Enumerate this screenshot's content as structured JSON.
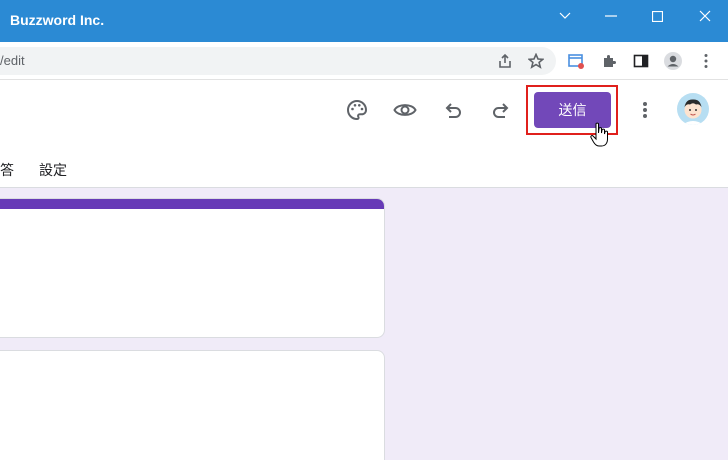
{
  "window": {
    "title": "Buzzword Inc."
  },
  "addressbar": {
    "url": "/edit"
  },
  "header": {
    "send_label": "送信"
  },
  "tabs": [
    {
      "label": "答"
    },
    {
      "label": "設定"
    }
  ],
  "colors": {
    "accent": "#673ab7",
    "send_button": "#7248b9",
    "titlebar": "#2b8ad4",
    "background": "#f0ebf8",
    "highlight": "#e0201c"
  }
}
